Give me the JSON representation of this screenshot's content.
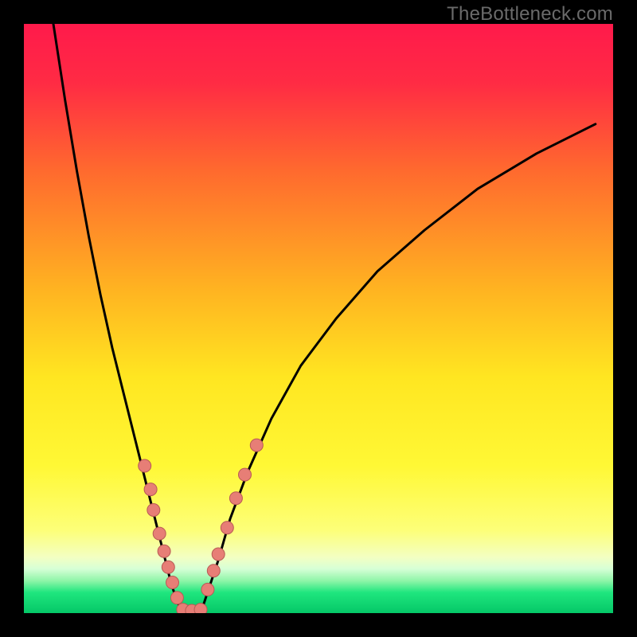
{
  "watermark": {
    "text": "TheBottleneck.com"
  },
  "chart_data": {
    "type": "line",
    "title": "",
    "xlabel": "",
    "ylabel": "",
    "xlim": [
      0,
      100
    ],
    "ylim": [
      0,
      100
    ],
    "grid": false,
    "legend": false,
    "background_gradient_stops": [
      {
        "pos": 0.0,
        "color": "#ff1a4b"
      },
      {
        "pos": 0.1,
        "color": "#ff2b44"
      },
      {
        "pos": 0.25,
        "color": "#ff6a2e"
      },
      {
        "pos": 0.45,
        "color": "#ffb321"
      },
      {
        "pos": 0.6,
        "color": "#ffe621"
      },
      {
        "pos": 0.75,
        "color": "#fff835"
      },
      {
        "pos": 0.86,
        "color": "#fdff79"
      },
      {
        "pos": 0.905,
        "color": "#f3ffc2"
      },
      {
        "pos": 0.925,
        "color": "#d6ffd6"
      },
      {
        "pos": 0.945,
        "color": "#8ff5a8"
      },
      {
        "pos": 0.965,
        "color": "#1fe67e"
      },
      {
        "pos": 1.0,
        "color": "#05c767"
      }
    ],
    "series": [
      {
        "name": "curve-left",
        "stroke": "#000000",
        "stroke_width": 3,
        "x": [
          5,
          7,
          9,
          11,
          13,
          15,
          17,
          19,
          21,
          23,
          24,
          25,
          26,
          27
        ],
        "y": [
          100,
          87,
          75,
          64,
          54,
          45,
          37,
          29,
          21,
          13,
          9,
          5,
          2,
          0
        ]
      },
      {
        "name": "curve-right",
        "stroke": "#000000",
        "stroke_width": 3,
        "x": [
          30,
          31,
          33,
          35,
          38,
          42,
          47,
          53,
          60,
          68,
          77,
          87,
          97
        ],
        "y": [
          0,
          3,
          9,
          16,
          24,
          33,
          42,
          50,
          58,
          65,
          72,
          78,
          83
        ]
      },
      {
        "name": "floor",
        "stroke": "#000000",
        "stroke_width": 3,
        "x": [
          27,
          28,
          29,
          30
        ],
        "y": [
          0,
          0,
          0,
          0
        ]
      }
    ],
    "markers": {
      "color": "#e77e76",
      "stroke": "#b85a54",
      "radius": 8,
      "points": [
        {
          "x": 20.5,
          "y": 25
        },
        {
          "x": 21.5,
          "y": 21
        },
        {
          "x": 22.0,
          "y": 17.5
        },
        {
          "x": 23.0,
          "y": 13.5
        },
        {
          "x": 23.8,
          "y": 10.5
        },
        {
          "x": 24.5,
          "y": 7.8
        },
        {
          "x": 25.2,
          "y": 5.2
        },
        {
          "x": 26.0,
          "y": 2.6
        },
        {
          "x": 27.0,
          "y": 0.6
        },
        {
          "x": 28.5,
          "y": 0.4
        },
        {
          "x": 30.0,
          "y": 0.6
        },
        {
          "x": 31.2,
          "y": 4.0
        },
        {
          "x": 32.2,
          "y": 7.2
        },
        {
          "x": 33.0,
          "y": 10.0
        },
        {
          "x": 34.5,
          "y": 14.5
        },
        {
          "x": 36.0,
          "y": 19.5
        },
        {
          "x": 37.5,
          "y": 23.5
        },
        {
          "x": 39.5,
          "y": 28.5
        }
      ]
    }
  }
}
